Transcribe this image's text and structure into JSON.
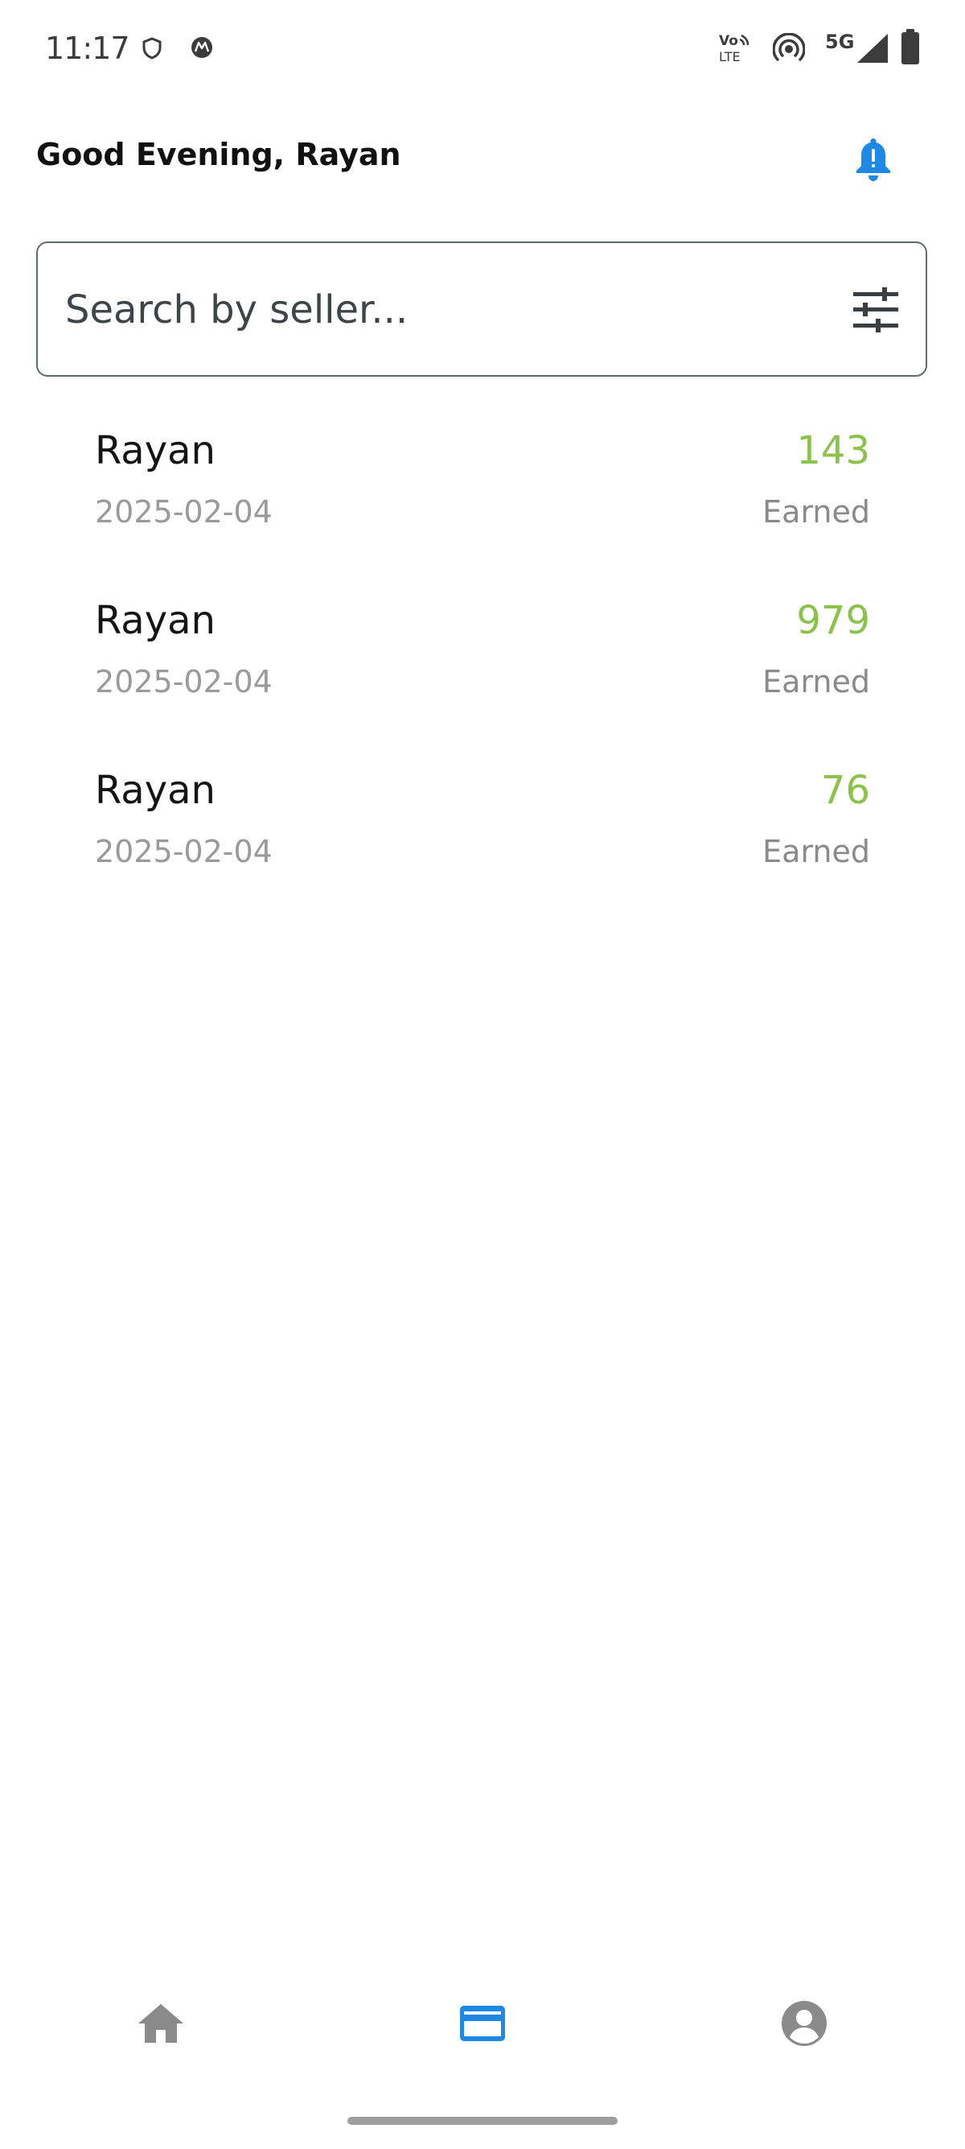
{
  "status_bar": {
    "time": "11:17",
    "icons": [
      "shield-icon",
      "motorola-icon",
      "volte-icon",
      "hotspot-icon",
      "5g-icon",
      "signal-icon",
      "battery-icon"
    ],
    "network_label": "5G",
    "volte_label_top": "Vo",
    "volte_label_bottom": "LTE"
  },
  "header": {
    "greeting": "Good Evening, Rayan",
    "bell_icon": "bell-icon"
  },
  "colors": {
    "accent": "#1e88e5",
    "amount": "#8bc34a",
    "muted": "#9a9a9a",
    "nav_inactive": "#8a8a8a"
  },
  "search": {
    "placeholder": "Search by seller...",
    "value": "",
    "filter_icon": "tune-icon"
  },
  "transactions": [
    {
      "seller": "Rayan",
      "date": "2025-02-04",
      "amount": "143",
      "status": "Earned"
    },
    {
      "seller": "Rayan",
      "date": "2025-02-04",
      "amount": "979",
      "status": "Earned"
    },
    {
      "seller": "Rayan",
      "date": "2025-02-04",
      "amount": "76",
      "status": "Earned"
    }
  ],
  "bottom_nav": {
    "items": [
      {
        "icon": "home-icon",
        "active": false
      },
      {
        "icon": "credit-card-icon",
        "active": true
      },
      {
        "icon": "account-icon",
        "active": false
      }
    ]
  }
}
